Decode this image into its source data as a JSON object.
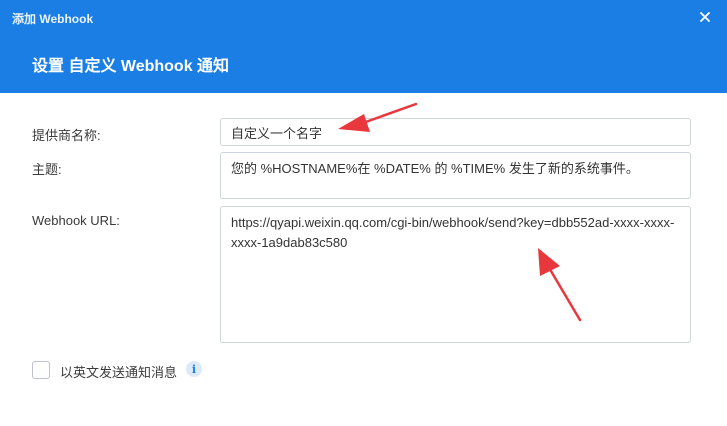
{
  "window": {
    "title": "添加 Webhook"
  },
  "dialog": {
    "heading": "设置 自定义 Webhook 通知"
  },
  "form": {
    "provider": {
      "label": "提供商名称:",
      "value": "自定义一个名字"
    },
    "subject": {
      "label": "主题:",
      "value": "您的 %HOSTNAME%在 %DATE% 的 %TIME% 发生了新的系统事件。"
    },
    "url": {
      "label": "Webhook URL:",
      "value": "https://qyapi.weixin.qq.com/cgi-bin/webhook/send?key=dbb552ad-xxxx-xxxx-xxxx-1a9dab83c580"
    },
    "english_option": {
      "label": "以英文发送通知消息",
      "checked": false
    }
  },
  "icons": {
    "close": "close-icon",
    "info": "info-icon",
    "annotation": "red-arrow-icon"
  },
  "colors": {
    "header": "#1a7ee5",
    "annotation": "#e8383d"
  }
}
